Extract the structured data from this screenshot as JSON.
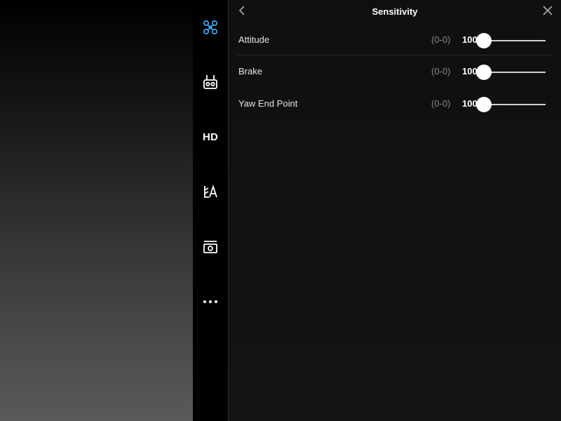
{
  "colors": {
    "accent": "#3ea0e8",
    "panel_bg": "#111111",
    "text_primary": "#ffffff",
    "text_secondary": "#8a8a8a"
  },
  "sidebar": {
    "items": [
      {
        "name": "aircraft",
        "icon": "drone-icon",
        "active": true
      },
      {
        "name": "remote-controller",
        "icon": "remote-controller-icon",
        "active": false
      },
      {
        "name": "hd",
        "label": "HD",
        "active": false
      },
      {
        "name": "vision",
        "icon": "vision-icon",
        "active": false
      },
      {
        "name": "camera",
        "icon": "camera-icon",
        "active": false
      },
      {
        "name": "more",
        "icon": "more-icon",
        "active": false
      }
    ]
  },
  "panel": {
    "title": "Sensitivity",
    "back_icon": "chevron-left-icon",
    "close_icon": "close-icon",
    "rows": [
      {
        "label": "Attitude",
        "range": "(0-0)",
        "value": "100",
        "slider_level": 0.0
      },
      {
        "label": "Brake",
        "range": "(0-0)",
        "value": "100",
        "slider_level": 0.0
      },
      {
        "label": "Yaw End Point",
        "range": "(0-0)",
        "value": "100",
        "slider_level": 0.0
      }
    ]
  }
}
